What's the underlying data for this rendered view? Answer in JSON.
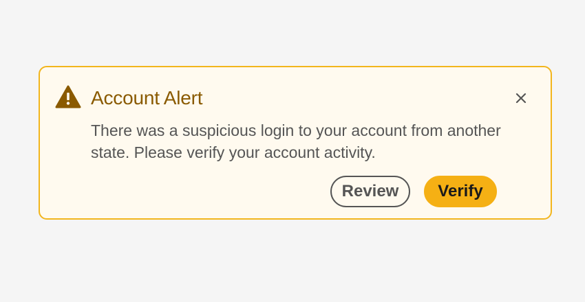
{
  "alert": {
    "icon": "warning-triangle-icon",
    "title": "Account Alert",
    "message": "There was a suspicious login to your account from another state. Please verify your account activity.",
    "close_icon": "close-icon",
    "actions": {
      "review_label": "Review",
      "verify_label": "Verify"
    }
  },
  "colors": {
    "page_background": "#f5f5f5",
    "alert_background": "#fffaef",
    "alert_border": "#f2b51c",
    "title": "#8a5a00",
    "primary_button": "#f5b014"
  }
}
